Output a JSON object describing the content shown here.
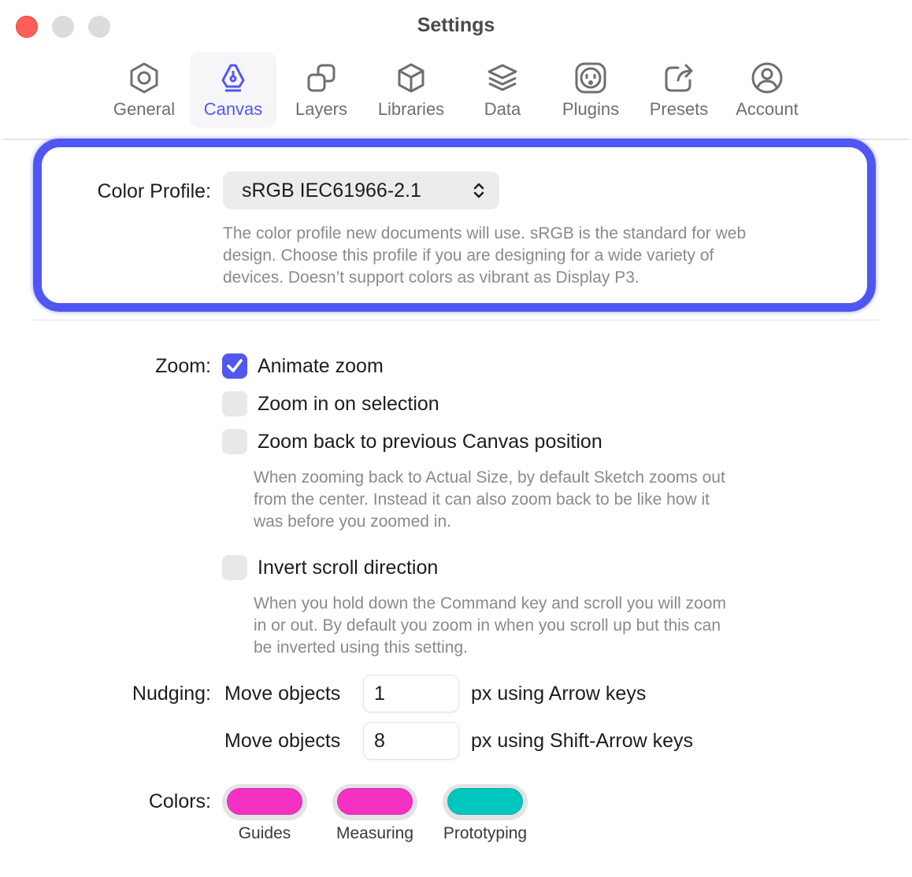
{
  "window": {
    "title": "Settings"
  },
  "toolbar": {
    "tabs": [
      {
        "label": "General",
        "icon": "hexagon-gear-icon"
      },
      {
        "label": "Canvas",
        "icon": "pen-nib-icon",
        "selected": true
      },
      {
        "label": "Layers",
        "icon": "stacked-squares-icon"
      },
      {
        "label": "Libraries",
        "icon": "cube-icon"
      },
      {
        "label": "Data",
        "icon": "layers-stack-icon"
      },
      {
        "label": "Plugins",
        "icon": "plug-outlet-icon"
      },
      {
        "label": "Presets",
        "icon": "share-arrow-icon"
      },
      {
        "label": "Account",
        "icon": "person-circle-icon"
      }
    ]
  },
  "color_profile": {
    "label": "Color Profile:",
    "value": "sRGB IEC61966-2.1",
    "help_lines": [
      "The color profile new documents will use. sRGB is the standard for web",
      "design. Choose this profile if you are designing for a wide variety of",
      "devices. Doesn’t support colors as vibrant as Display P3."
    ]
  },
  "zoom": {
    "label": "Zoom:",
    "options": [
      {
        "label": "Animate zoom",
        "checked": true
      },
      {
        "label": "Zoom in on selection",
        "checked": false
      },
      {
        "label": "Zoom back to previous Canvas position",
        "checked": false
      },
      {
        "label": "Invert scroll direction",
        "checked": false
      }
    ],
    "zoom_back_help_lines": [
      "When zooming back to Actual Size, by default Sketch zooms out",
      "from the center. Instead it can also zoom back to be like how it",
      "was before you zoomed in."
    ],
    "invert_help_lines": [
      "When you hold down the Command key and scroll you will zoom",
      "in or out. By default you zoom in when you scroll up but this can",
      "be inverted using this setting."
    ]
  },
  "nudging": {
    "label": "Nudging:",
    "rows": [
      {
        "prefix": "Move objects",
        "value": "1",
        "suffix": "px using Arrow keys"
      },
      {
        "prefix": "Move objects",
        "value": "8",
        "suffix": "px using Shift-Arrow keys"
      }
    ]
  },
  "colors": {
    "label": "Colors:",
    "swatches": [
      {
        "label": "Guides",
        "color": "#f531c4"
      },
      {
        "label": "Measuring",
        "color": "#f531c4"
      },
      {
        "label": "Prototyping",
        "color": "#00c7be"
      }
    ]
  },
  "accent_color": "#5158f0"
}
